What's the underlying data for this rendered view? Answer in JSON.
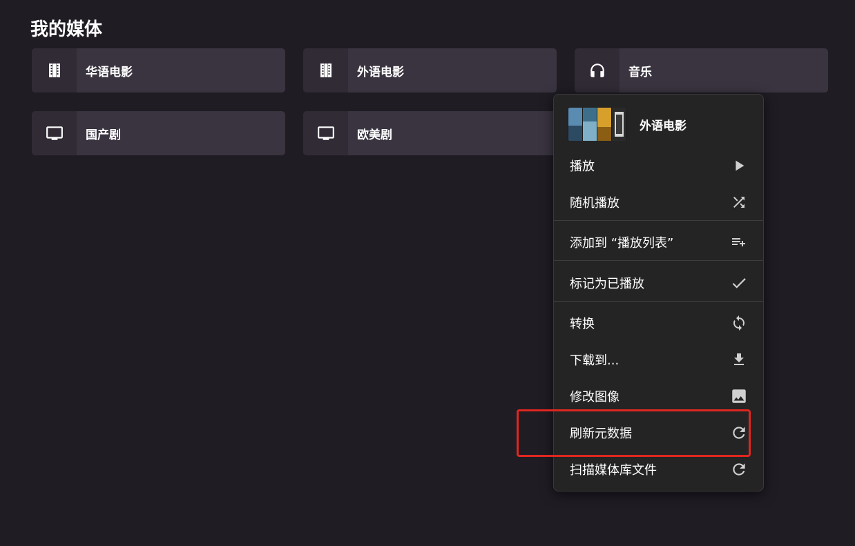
{
  "section": {
    "title": "我的媒体"
  },
  "libraries": [
    {
      "label": "华语电影",
      "icon": "film-icon"
    },
    {
      "label": "外语电影",
      "icon": "film-icon"
    },
    {
      "label": "音乐",
      "icon": "headphones-icon"
    },
    {
      "label": "国产剧",
      "icon": "tv-icon"
    },
    {
      "label": "欧美剧",
      "icon": "tv-icon"
    }
  ],
  "context_menu": {
    "title": "外语电影",
    "items": [
      {
        "label": "播放",
        "icon": "play-icon"
      },
      {
        "label": "随机播放",
        "icon": "shuffle-icon"
      },
      {
        "label": "添加到 “播放列表”",
        "icon": "playlist-add-icon"
      },
      {
        "label": "标记为已播放",
        "icon": "check-icon"
      },
      {
        "label": "转换",
        "icon": "sync-icon"
      },
      {
        "label": "下载到...",
        "icon": "download-icon"
      },
      {
        "label": "修改图像",
        "icon": "image-icon"
      },
      {
        "label": "刷新元数据",
        "icon": "refresh-icon"
      },
      {
        "label": "扫描媒体库文件",
        "icon": "refresh-icon"
      }
    ]
  },
  "colors": {
    "background": "#1f1c24",
    "card": "#3a3440",
    "menu": "#242424",
    "highlight": "#e0261f"
  }
}
